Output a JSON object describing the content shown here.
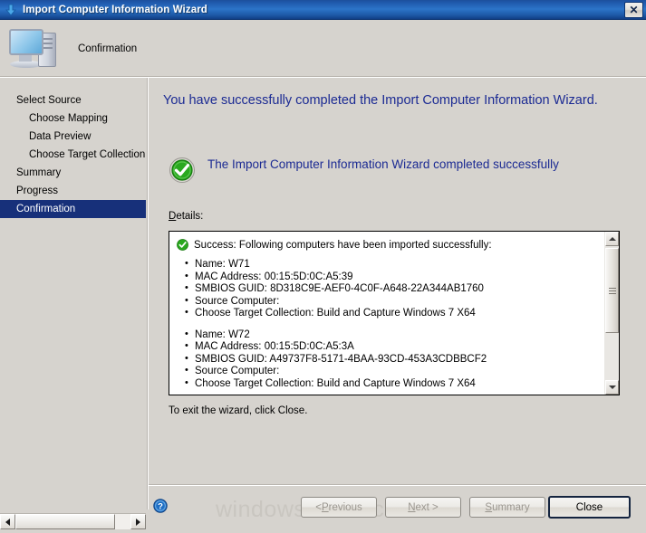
{
  "window": {
    "title": "Import Computer Information Wizard",
    "title_icon": "import-arrow-icon",
    "close_label": "✕"
  },
  "banner": {
    "icon": "computer-icon",
    "title": "Confirmation"
  },
  "sidebar": {
    "items": [
      {
        "label": "Select Source",
        "indent": false,
        "active": false
      },
      {
        "label": "Choose Mapping",
        "indent": true,
        "active": false
      },
      {
        "label": "Data Preview",
        "indent": true,
        "active": false
      },
      {
        "label": "Choose Target Collection",
        "indent": true,
        "active": false
      },
      {
        "label": "Summary",
        "indent": false,
        "active": false
      },
      {
        "label": "Progress",
        "indent": false,
        "active": false
      },
      {
        "label": "Confirmation",
        "indent": false,
        "active": true
      }
    ]
  },
  "content": {
    "headline": "You have successfully completed the Import Computer Information Wizard.",
    "success_icon": "green-check-circle-icon",
    "success_message": "The Import Computer Information Wizard completed successfully",
    "details_label_accelerator": "D",
    "details_label_rest": "etails:",
    "details": {
      "status_icon": "green-check-small-icon",
      "status_line": "Success: Following computers have been imported successfully:",
      "groups": [
        [
          "Name: W71",
          "MAC Address: 00:15:5D:0C:A5:39",
          "SMBIOS GUID: 8D318C9E-AEF0-4C0F-A648-22A344AB1760",
          "Source Computer:",
          "Choose Target Collection: Build and Capture Windows 7 X64"
        ],
        [
          "Name: W72",
          "MAC Address: 00:15:5D:0C:A5:3A",
          "SMBIOS GUID: A49737F8-5171-4BAA-93CD-453A3CDBBCF2",
          "Source Computer:",
          "Choose Target Collection: Build and Capture Windows 7 X64"
        ]
      ]
    },
    "exit_note": "To exit the wizard, click Close."
  },
  "footer": {
    "help_icon": "help-question-icon",
    "buttons": [
      {
        "name": "previous",
        "prefix": "< ",
        "acc": "P",
        "suffix": "revious",
        "disabled": true,
        "default": false
      },
      {
        "name": "next",
        "prefix": "",
        "acc": "N",
        "suffix": "ext >",
        "disabled": true,
        "default": false
      },
      {
        "name": "summary",
        "prefix": "",
        "acc": "S",
        "suffix": "ummary",
        "disabled": true,
        "default": false
      },
      {
        "name": "close",
        "prefix": "",
        "acc": "",
        "suffix": "Close",
        "disabled": false,
        "default": true
      }
    ]
  },
  "watermark": {
    "text": "windows-noob.com"
  },
  "colors": {
    "titlebar_blue": "#2c74c8",
    "sidebar_active": "#17307a",
    "heading_blue": "#1b2a93",
    "face": "#d6d3ce",
    "success_green": "#27a41c"
  }
}
